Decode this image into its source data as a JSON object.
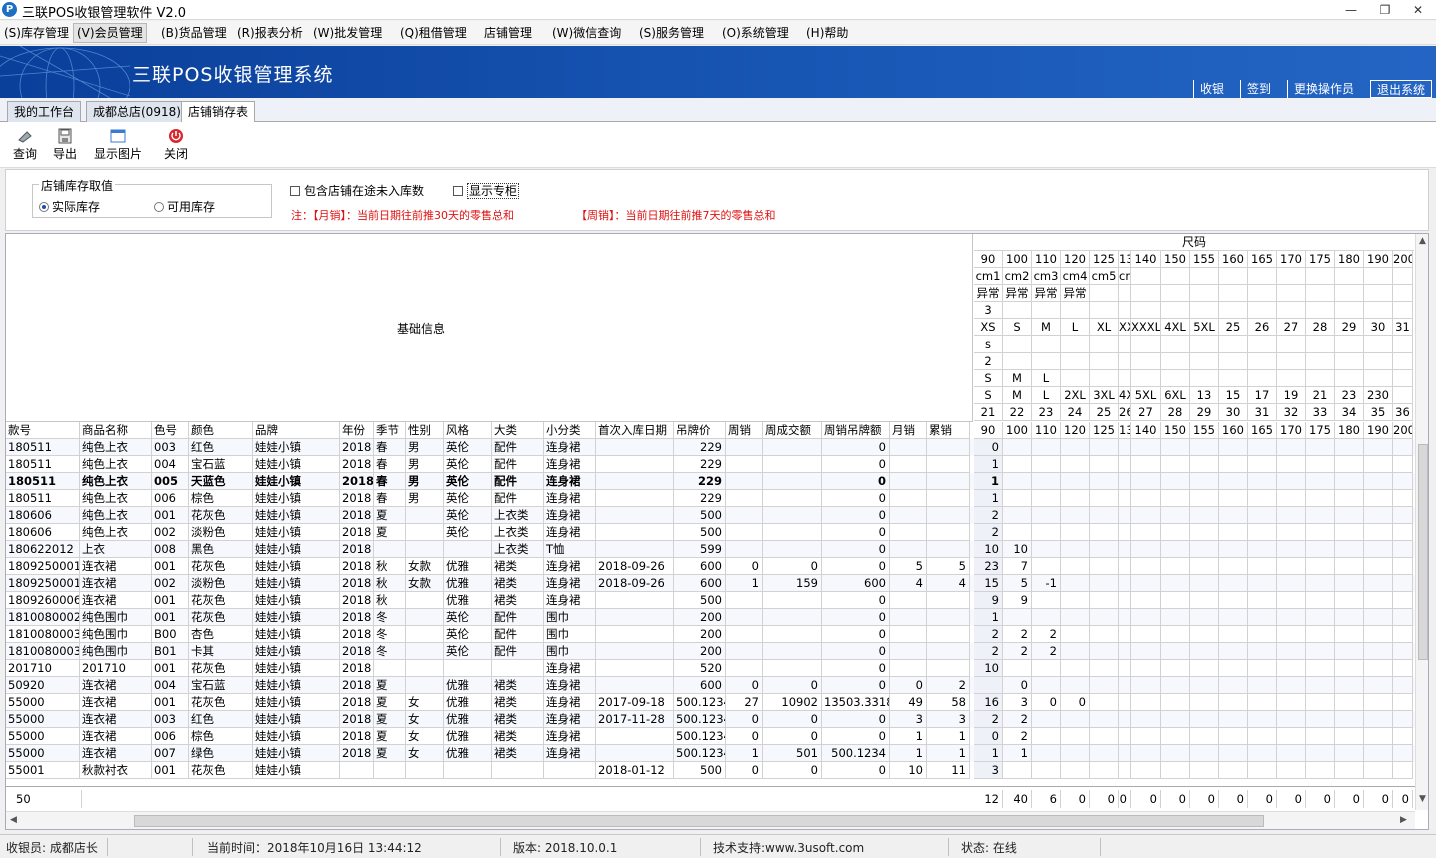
{
  "window": {
    "title": "三联POS收银管理软件 V2.0",
    "icon_letter": "P",
    "min_glyph": "—",
    "restore_glyph": "❐",
    "close_glyph": "✕"
  },
  "menu": [
    "(S)库存管理",
    "(V)会员管理",
    "(B)货品管理",
    "(R)报表分析",
    "(W)批发管理",
    "(Q)租借管理",
    "店铺管理",
    "(W)微信查询",
    "(S)服务管理",
    "(O)系统管理",
    "(H)帮助"
  ],
  "banner": {
    "title": "三联POS收银管理系统",
    "nav": [
      "收银",
      "签到",
      "更换操作员",
      "退出系统"
    ]
  },
  "tabs": [
    "我的工作台",
    "成都总店(0918)",
    "店铺销存表"
  ],
  "toolbar": {
    "query": "查询",
    "export": "导出",
    "show_image": "显示图片",
    "close": "关闭"
  },
  "filter": {
    "group_title": "店铺库存取值",
    "radio_actual": "实际库存",
    "radio_available": "可用库存",
    "checkbox_transit": "包含店铺在途未入库数",
    "checkbox_counter": "显示专柜",
    "note_month": "注：【月销】：当前日期往前推30天的零售总和",
    "note_week": "【周销】：当前日期往前推7天的零售总和"
  },
  "grid": {
    "basic_info_label": "基础信息",
    "size_header": "尺码",
    "size_rows": [
      [
        "90",
        "100",
        "110",
        "120",
        "125",
        "130",
        "140",
        "150",
        "155",
        "160",
        "165",
        "170",
        "175",
        "180",
        "190",
        "200"
      ],
      [
        "cm1",
        "cm2",
        "cm3",
        "cm4",
        "cm5",
        "cm6",
        "",
        "",
        "",
        "",
        "",
        "",
        "",
        "",
        "",
        ""
      ],
      [
        "异常",
        "异常",
        "异常",
        "异常",
        "",
        "",
        "",
        "",
        "",
        "",
        "",
        "",
        "",
        "",
        "",
        ""
      ],
      [
        "3",
        "",
        "",
        "",
        "",
        "",
        "",
        "",
        "",
        "",
        "",
        "",
        "",
        "",
        "",
        ""
      ],
      [
        "XS",
        "S",
        "M",
        "L",
        "XL",
        "XXL",
        "XXXL",
        "4XL",
        "5XL",
        "25",
        "26",
        "27",
        "28",
        "29",
        "30",
        "31"
      ],
      [
        "s",
        "",
        "",
        "",
        "",
        "",
        "",
        "",
        "",
        "",
        "",
        "",
        "",
        "",
        "",
        ""
      ],
      [
        "2",
        "",
        "",
        "",
        "",
        "",
        "",
        "",
        "",
        "",
        "",
        "",
        "",
        "",
        "",
        ""
      ],
      [
        "S",
        "M",
        "L",
        "",
        "",
        "",
        "",
        "",
        "",
        "",
        "",
        "",
        "",
        "",
        "",
        ""
      ],
      [
        "S",
        "M",
        "L",
        "2XL",
        "3XL",
        "4XL",
        "5XL",
        "6XL",
        "13",
        "15",
        "17",
        "19",
        "21",
        "23",
        "230",
        ""
      ],
      [
        "21",
        "22",
        "23",
        "24",
        "25",
        "26",
        "27",
        "28",
        "29",
        "30",
        "31",
        "32",
        "33",
        "34",
        "35",
        "36"
      ]
    ],
    "columns": [
      "款号",
      "商品名称",
      "色号",
      "颜色",
      "品牌",
      "年份",
      "季节",
      "性别",
      "风格",
      "大类",
      "小分类",
      "首次入库日期",
      "吊牌价",
      "周销",
      "周成交额",
      "周销吊牌额",
      "月销",
      "累销"
    ],
    "size_columns": [
      "90",
      "100",
      "110",
      "120",
      "125",
      "130",
      "140",
      "150",
      "155",
      "160",
      "165",
      "170",
      "175",
      "180",
      "190",
      "200"
    ],
    "rows": [
      {
        "c": [
          "180511",
          "纯色上衣",
          "003",
          "红色",
          "娃娃小镇",
          "2018",
          "春",
          "男",
          "英伦",
          "配件",
          "连身裙",
          "",
          "229",
          "",
          "",
          "0",
          "",
          ""
        ],
        "s": [
          "0"
        ]
      },
      {
        "c": [
          "180511",
          "纯色上衣",
          "004",
          "宝石蓝",
          "娃娃小镇",
          "2018",
          "春",
          "男",
          "英伦",
          "配件",
          "连身裙",
          "",
          "229",
          "",
          "",
          "0",
          "",
          ""
        ],
        "s": [
          "1"
        ]
      },
      {
        "c": [
          "180511",
          "纯色上衣",
          "005",
          "天蓝色",
          "娃娃小镇",
          "2018",
          "春",
          "男",
          "英伦",
          "配件",
          "连身裙",
          "",
          "229",
          "",
          "",
          "0",
          "",
          ""
        ],
        "s": [
          "1"
        ],
        "bold": true
      },
      {
        "c": [
          "180511",
          "纯色上衣",
          "006",
          "棕色",
          "娃娃小镇",
          "2018",
          "春",
          "男",
          "英伦",
          "配件",
          "连身裙",
          "",
          "229",
          "",
          "",
          "0",
          "",
          ""
        ],
        "s": [
          "1"
        ]
      },
      {
        "c": [
          "180606",
          "纯色上衣",
          "001",
          "花灰色",
          "娃娃小镇",
          "2018",
          "夏",
          "",
          "英伦",
          "上衣类",
          "连身裙",
          "",
          "500",
          "",
          "",
          "0",
          "",
          ""
        ],
        "s": [
          "2"
        ]
      },
      {
        "c": [
          "180606",
          "纯色上衣",
          "002",
          "淡粉色",
          "娃娃小镇",
          "2018",
          "夏",
          "",
          "英伦",
          "上衣类",
          "连身裙",
          "",
          "500",
          "",
          "",
          "0",
          "",
          ""
        ],
        "s": [
          "2"
        ]
      },
      {
        "c": [
          "180622012",
          "上衣",
          "008",
          "黑色",
          "娃娃小镇",
          "2018",
          "",
          "",
          "",
          "上衣类",
          "T恤",
          "",
          "599",
          "",
          "",
          "0",
          "",
          ""
        ],
        "s": [
          "10",
          "10"
        ]
      },
      {
        "c": [
          "1809250001",
          "连衣裙",
          "001",
          "花灰色",
          "娃娃小镇",
          "2018",
          "秋",
          "女款",
          "优雅",
          "裙类",
          "连身裙",
          "2018-09-26",
          "600",
          "0",
          "0",
          "0",
          "5",
          "5"
        ],
        "s": [
          "23",
          "7"
        ]
      },
      {
        "c": [
          "1809250001",
          "连衣裙",
          "002",
          "淡粉色",
          "娃娃小镇",
          "2018",
          "秋",
          "女款",
          "优雅",
          "裙类",
          "连身裙",
          "2018-09-26",
          "600",
          "1",
          "159",
          "600",
          "4",
          "4"
        ],
        "s": [
          "15",
          "5",
          "-1"
        ]
      },
      {
        "c": [
          "1809260006",
          "连衣裙",
          "001",
          "花灰色",
          "娃娃小镇",
          "2018",
          "秋",
          "",
          "优雅",
          "裙类",
          "连身裙",
          "",
          "500",
          "",
          "",
          "0",
          "",
          ""
        ],
        "s": [
          "9",
          "9"
        ]
      },
      {
        "c": [
          "1810080002",
          "纯色围巾",
          "001",
          "花灰色",
          "娃娃小镇",
          "2018",
          "冬",
          "",
          "英伦",
          "配件",
          "围巾",
          "",
          "200",
          "",
          "",
          "0",
          "",
          ""
        ],
        "s": [
          "1"
        ]
      },
      {
        "c": [
          "1810080003",
          "纯色围巾",
          "B00",
          "杏色",
          "娃娃小镇",
          "2018",
          "冬",
          "",
          "英伦",
          "配件",
          "围巾",
          "",
          "200",
          "",
          "",
          "0",
          "",
          ""
        ],
        "s": [
          "2",
          "2",
          "2"
        ]
      },
      {
        "c": [
          "1810080003",
          "纯色围巾",
          "B01",
          "卡其",
          "娃娃小镇",
          "2018",
          "冬",
          "",
          "英伦",
          "配件",
          "围巾",
          "",
          "200",
          "",
          "",
          "0",
          "",
          ""
        ],
        "s": [
          "2",
          "2",
          "2"
        ]
      },
      {
        "c": [
          "201710",
          "201710",
          "001",
          "花灰色",
          "娃娃小镇",
          "2018",
          "",
          "",
          "",
          "",
          "连身裙",
          "",
          "520",
          "",
          "",
          "0",
          "",
          ""
        ],
        "s": [
          "10"
        ]
      },
      {
        "c": [
          "50920",
          "连衣裙",
          "004",
          "宝石蓝",
          "娃娃小镇",
          "2018",
          "夏",
          "",
          "优雅",
          "裙类",
          "连身裙",
          "",
          "600",
          "0",
          "0",
          "0",
          "0",
          "2"
        ],
        "s": [
          "",
          "0"
        ]
      },
      {
        "c": [
          "55000",
          "连衣裙",
          "001",
          "花灰色",
          "娃娃小镇",
          "2018",
          "夏",
          "女",
          "优雅",
          "裙类",
          "连身裙",
          "2017-09-18",
          "500.1234",
          "27",
          "10902",
          "13503.3318",
          "49",
          "58"
        ],
        "s": [
          "16",
          "3",
          "0",
          "0"
        ]
      },
      {
        "c": [
          "55000",
          "连衣裙",
          "003",
          "红色",
          "娃娃小镇",
          "2018",
          "夏",
          "女",
          "优雅",
          "裙类",
          "连身裙",
          "2017-11-28",
          "500.1234",
          "0",
          "0",
          "0",
          "3",
          "3"
        ],
        "s": [
          "2",
          "2"
        ]
      },
      {
        "c": [
          "55000",
          "连衣裙",
          "006",
          "棕色",
          "娃娃小镇",
          "2018",
          "夏",
          "女",
          "优雅",
          "裙类",
          "连身裙",
          "",
          "500.1234",
          "0",
          "0",
          "0",
          "1",
          "1"
        ],
        "s": [
          "0",
          "2"
        ]
      },
      {
        "c": [
          "55000",
          "连衣裙",
          "007",
          "绿色",
          "娃娃小镇",
          "2018",
          "夏",
          "女",
          "优雅",
          "裙类",
          "连身裙",
          "",
          "500.1234",
          "1",
          "501",
          "500.1234",
          "1",
          "1"
        ],
        "s": [
          "1",
          "1"
        ]
      },
      {
        "c": [
          "55001",
          "秋款衬衣",
          "001",
          "花灰色",
          "娃娃小镇",
          "",
          "",
          "",
          "",
          "",
          "",
          "2018-01-12",
          "500",
          "0",
          "0",
          "0",
          "10",
          "11"
        ],
        "s": [
          "3"
        ]
      }
    ],
    "footer": {
      "count": "50",
      "size_totals": [
        "12",
        "40",
        "6",
        "0",
        "0",
        "0",
        "0",
        "0",
        "0",
        "0",
        "0",
        "0",
        "0",
        "0",
        "0",
        "0"
      ]
    }
  },
  "status": {
    "cashier": "收银员: 成都店长",
    "time": "当前时间：2018年10月16日 13:44:12",
    "version": "版本: 2018.10.0.1",
    "support": "技术支持:www.3usoft.com",
    "state": "状态: 在线"
  }
}
